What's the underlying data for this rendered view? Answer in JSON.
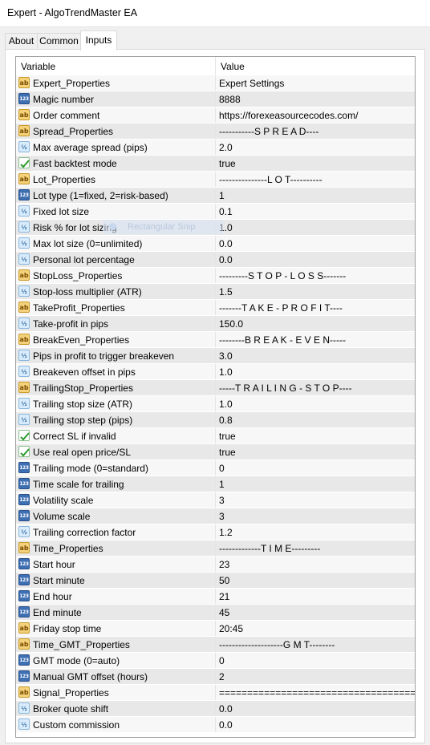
{
  "window": {
    "title": "Expert - AlgoTrendMaster EA"
  },
  "tabs": [
    {
      "label": "About",
      "active": false
    },
    {
      "label": "Common",
      "active": false
    },
    {
      "label": "Inputs",
      "active": true
    }
  ],
  "table": {
    "headers": {
      "variable": "Variable",
      "value": "Value"
    },
    "rows": [
      {
        "icon": "ab",
        "variable": "Expert_Properties",
        "value": "Expert Settings"
      },
      {
        "icon": "123",
        "variable": "Magic number",
        "value": "8888"
      },
      {
        "icon": "ab",
        "variable": "Order comment",
        "value": "https://forexeasourcecodes.com/"
      },
      {
        "icon": "ab",
        "variable": "Spread_Properties",
        "value": "-----------S P R E A D----"
      },
      {
        "icon": "v2",
        "variable": "Max average spread (pips)",
        "value": "2.0"
      },
      {
        "icon": "bool",
        "variable": "Fast backtest mode",
        "value": "true"
      },
      {
        "icon": "ab",
        "variable": "Lot_Properties",
        "value": "---------------L O T----------"
      },
      {
        "icon": "123",
        "variable": "Lot type (1=fixed, 2=risk-based)",
        "value": "1"
      },
      {
        "icon": "v2",
        "variable": "Fixed lot size",
        "value": "0.1"
      },
      {
        "icon": "v2",
        "variable": "Risk % for lot sizing",
        "value": "1.0"
      },
      {
        "icon": "v2",
        "variable": "Max lot size (0=unlimited)",
        "value": "0.0"
      },
      {
        "icon": "v2",
        "variable": "Personal lot percentage",
        "value": "0.0"
      },
      {
        "icon": "ab",
        "variable": "StopLoss_Properties",
        "value": "---------S T O P - L O S S-------"
      },
      {
        "icon": "v2",
        "variable": "Stop-loss multiplier (ATR)",
        "value": "1.5"
      },
      {
        "icon": "ab",
        "variable": "TakeProfit_Properties",
        "value": "-------T A K E - P R O F I T----"
      },
      {
        "icon": "v2",
        "variable": "Take-profit in pips",
        "value": "150.0"
      },
      {
        "icon": "ab",
        "variable": "BreakEven_Properties",
        "value": "--------B R E A K - E V E N-----"
      },
      {
        "icon": "v2",
        "variable": "Pips in profit to trigger breakeven",
        "value": "3.0"
      },
      {
        "icon": "v2",
        "variable": "Breakeven offset in pips",
        "value": "1.0"
      },
      {
        "icon": "ab",
        "variable": "TrailingStop_Properties",
        "value": "-----T R A I L I N G - S T O P----"
      },
      {
        "icon": "v2",
        "variable": "Trailing stop size (ATR)",
        "value": "1.0"
      },
      {
        "icon": "v2",
        "variable": "Trailing stop step (pips)",
        "value": "0.8"
      },
      {
        "icon": "bool",
        "variable": "Correct SL if invalid",
        "value": "true"
      },
      {
        "icon": "bool",
        "variable": "Use real open price/SL",
        "value": "true"
      },
      {
        "icon": "123",
        "variable": "Trailing mode (0=standard)",
        "value": "0"
      },
      {
        "icon": "123",
        "variable": "Time scale for trailing",
        "value": "1"
      },
      {
        "icon": "123",
        "variable": "Volatility scale",
        "value": "3"
      },
      {
        "icon": "123",
        "variable": "Volume scale",
        "value": "3"
      },
      {
        "icon": "v2",
        "variable": "Trailing correction factor",
        "value": "1.2"
      },
      {
        "icon": "ab",
        "variable": "Time_Properties",
        "value": "-------------T I M E---------"
      },
      {
        "icon": "123",
        "variable": "Start hour",
        "value": "23"
      },
      {
        "icon": "123",
        "variable": "Start minute",
        "value": "50"
      },
      {
        "icon": "123",
        "variable": "End hour",
        "value": "21"
      },
      {
        "icon": "123",
        "variable": "End minute",
        "value": "45"
      },
      {
        "icon": "ab",
        "variable": "Friday stop time",
        "value": "20:45"
      },
      {
        "icon": "ab",
        "variable": "Time_GMT_Properties",
        "value": "--------------------G M T--------"
      },
      {
        "icon": "123",
        "variable": "GMT mode (0=auto)",
        "value": "0"
      },
      {
        "icon": "123",
        "variable": "Manual GMT offset (hours)",
        "value": "2"
      },
      {
        "icon": "ab",
        "variable": "Signal_Properties",
        "value": "======================================"
      },
      {
        "icon": "v2",
        "variable": "Broker quote shift",
        "value": "0.0"
      },
      {
        "icon": "v2",
        "variable": "Custom commission",
        "value": "0.0"
      }
    ]
  },
  "overlay": {
    "label": "Rectangular Snip"
  }
}
